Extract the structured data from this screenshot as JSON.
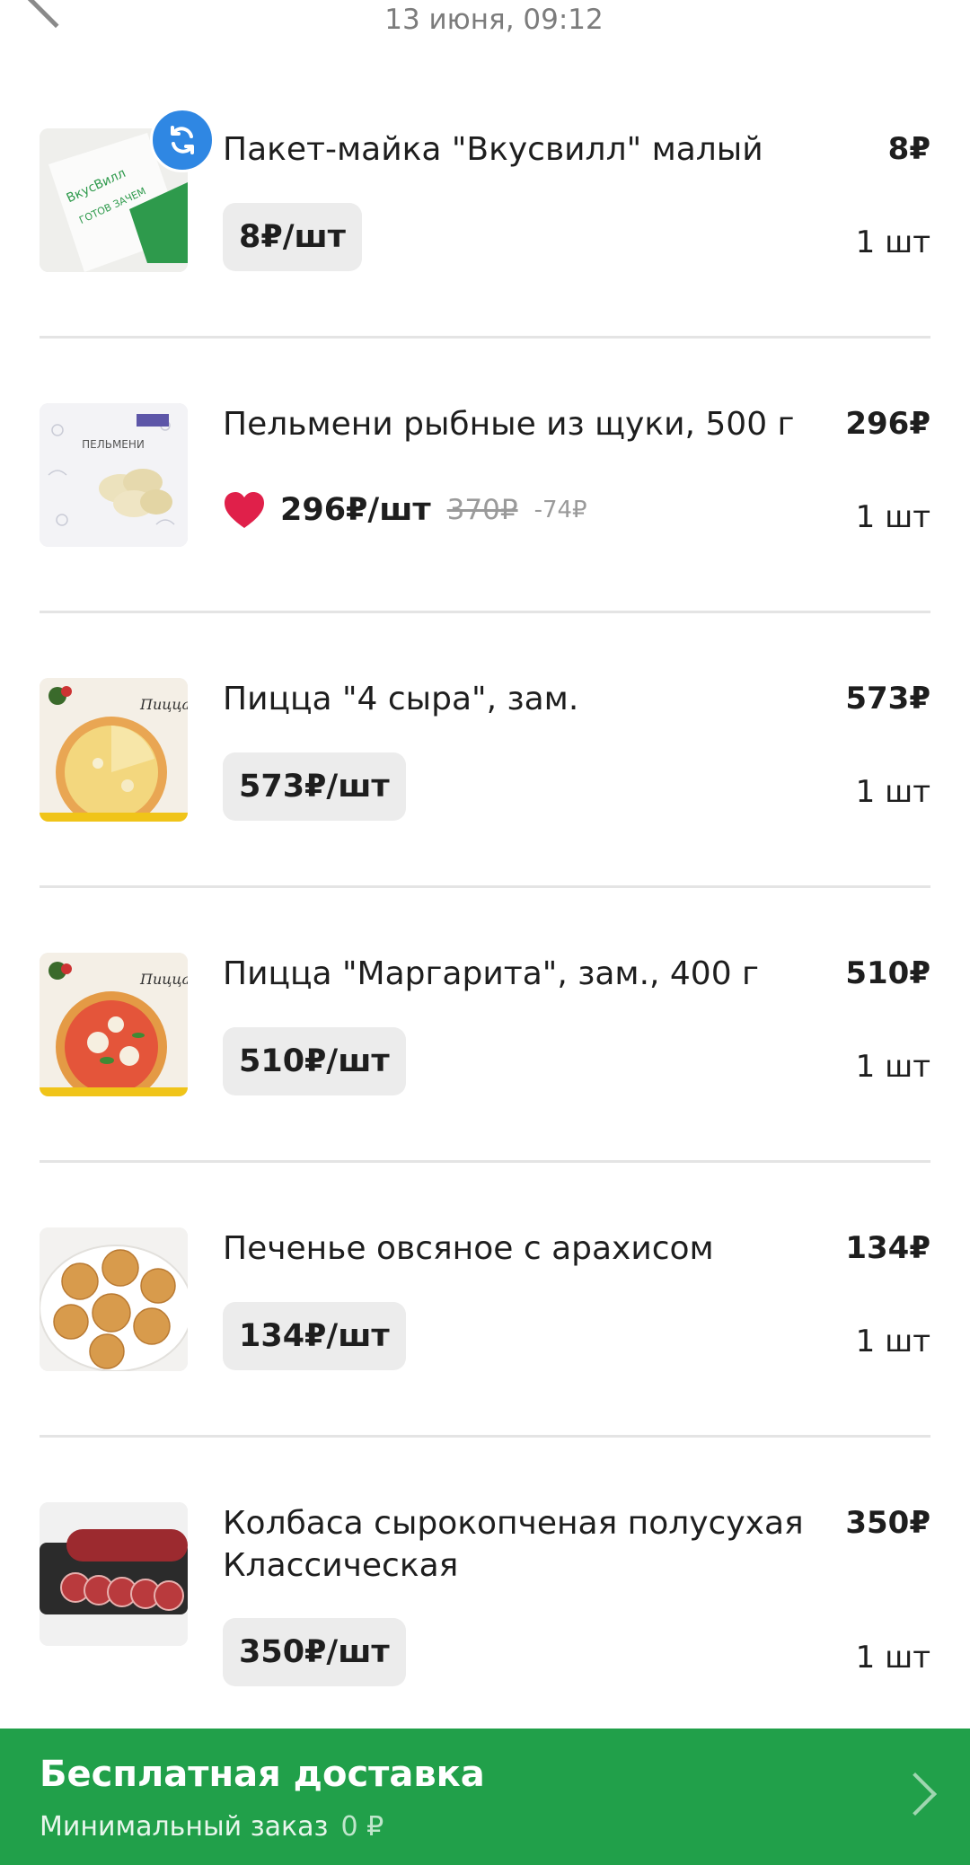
{
  "header": {
    "date": "13 июня, 09:12"
  },
  "items": [
    {
      "name": "Пакет-майка \"Вкусвилл\" малый",
      "total": "8₽",
      "unit_price": "8₽/шт",
      "qty": "1 шт"
    },
    {
      "name": "Пельмени рыбные из щуки, 500 г",
      "total": "296₽",
      "unit_price": "296₽/шт",
      "old_price": "370₽",
      "discount": "-74₽",
      "qty": "1 шт"
    },
    {
      "name": "Пицца \"4 сыра\", зам.",
      "total": "573₽",
      "unit_price": "573₽/шт",
      "qty": "1 шт"
    },
    {
      "name": "Пицца \"Маргарита\", зам., 400 г",
      "total": "510₽",
      "unit_price": "510₽/шт",
      "qty": "1 шт"
    },
    {
      "name": "Печенье овсяное с арахисом",
      "total": "134₽",
      "unit_price": "134₽/шт",
      "qty": "1 шт"
    },
    {
      "name": "Колбаса сырокопченая полусухая Классическая",
      "total": "350₽",
      "unit_price": "350₽/шт",
      "qty": "1 шт"
    }
  ],
  "footer": {
    "title": "Бесплатная доставка",
    "min_order_label": "Минимальный заказ",
    "min_order_value": "0 ₽"
  },
  "colors": {
    "accent_green": "#21a04a",
    "sync_blue": "#2f87e3",
    "heart_red": "#e0204a",
    "pill_bg": "#ececec"
  },
  "icons": [
    "back-chevron-icon",
    "sync-icon",
    "heart-icon",
    "chevron-right-icon"
  ]
}
